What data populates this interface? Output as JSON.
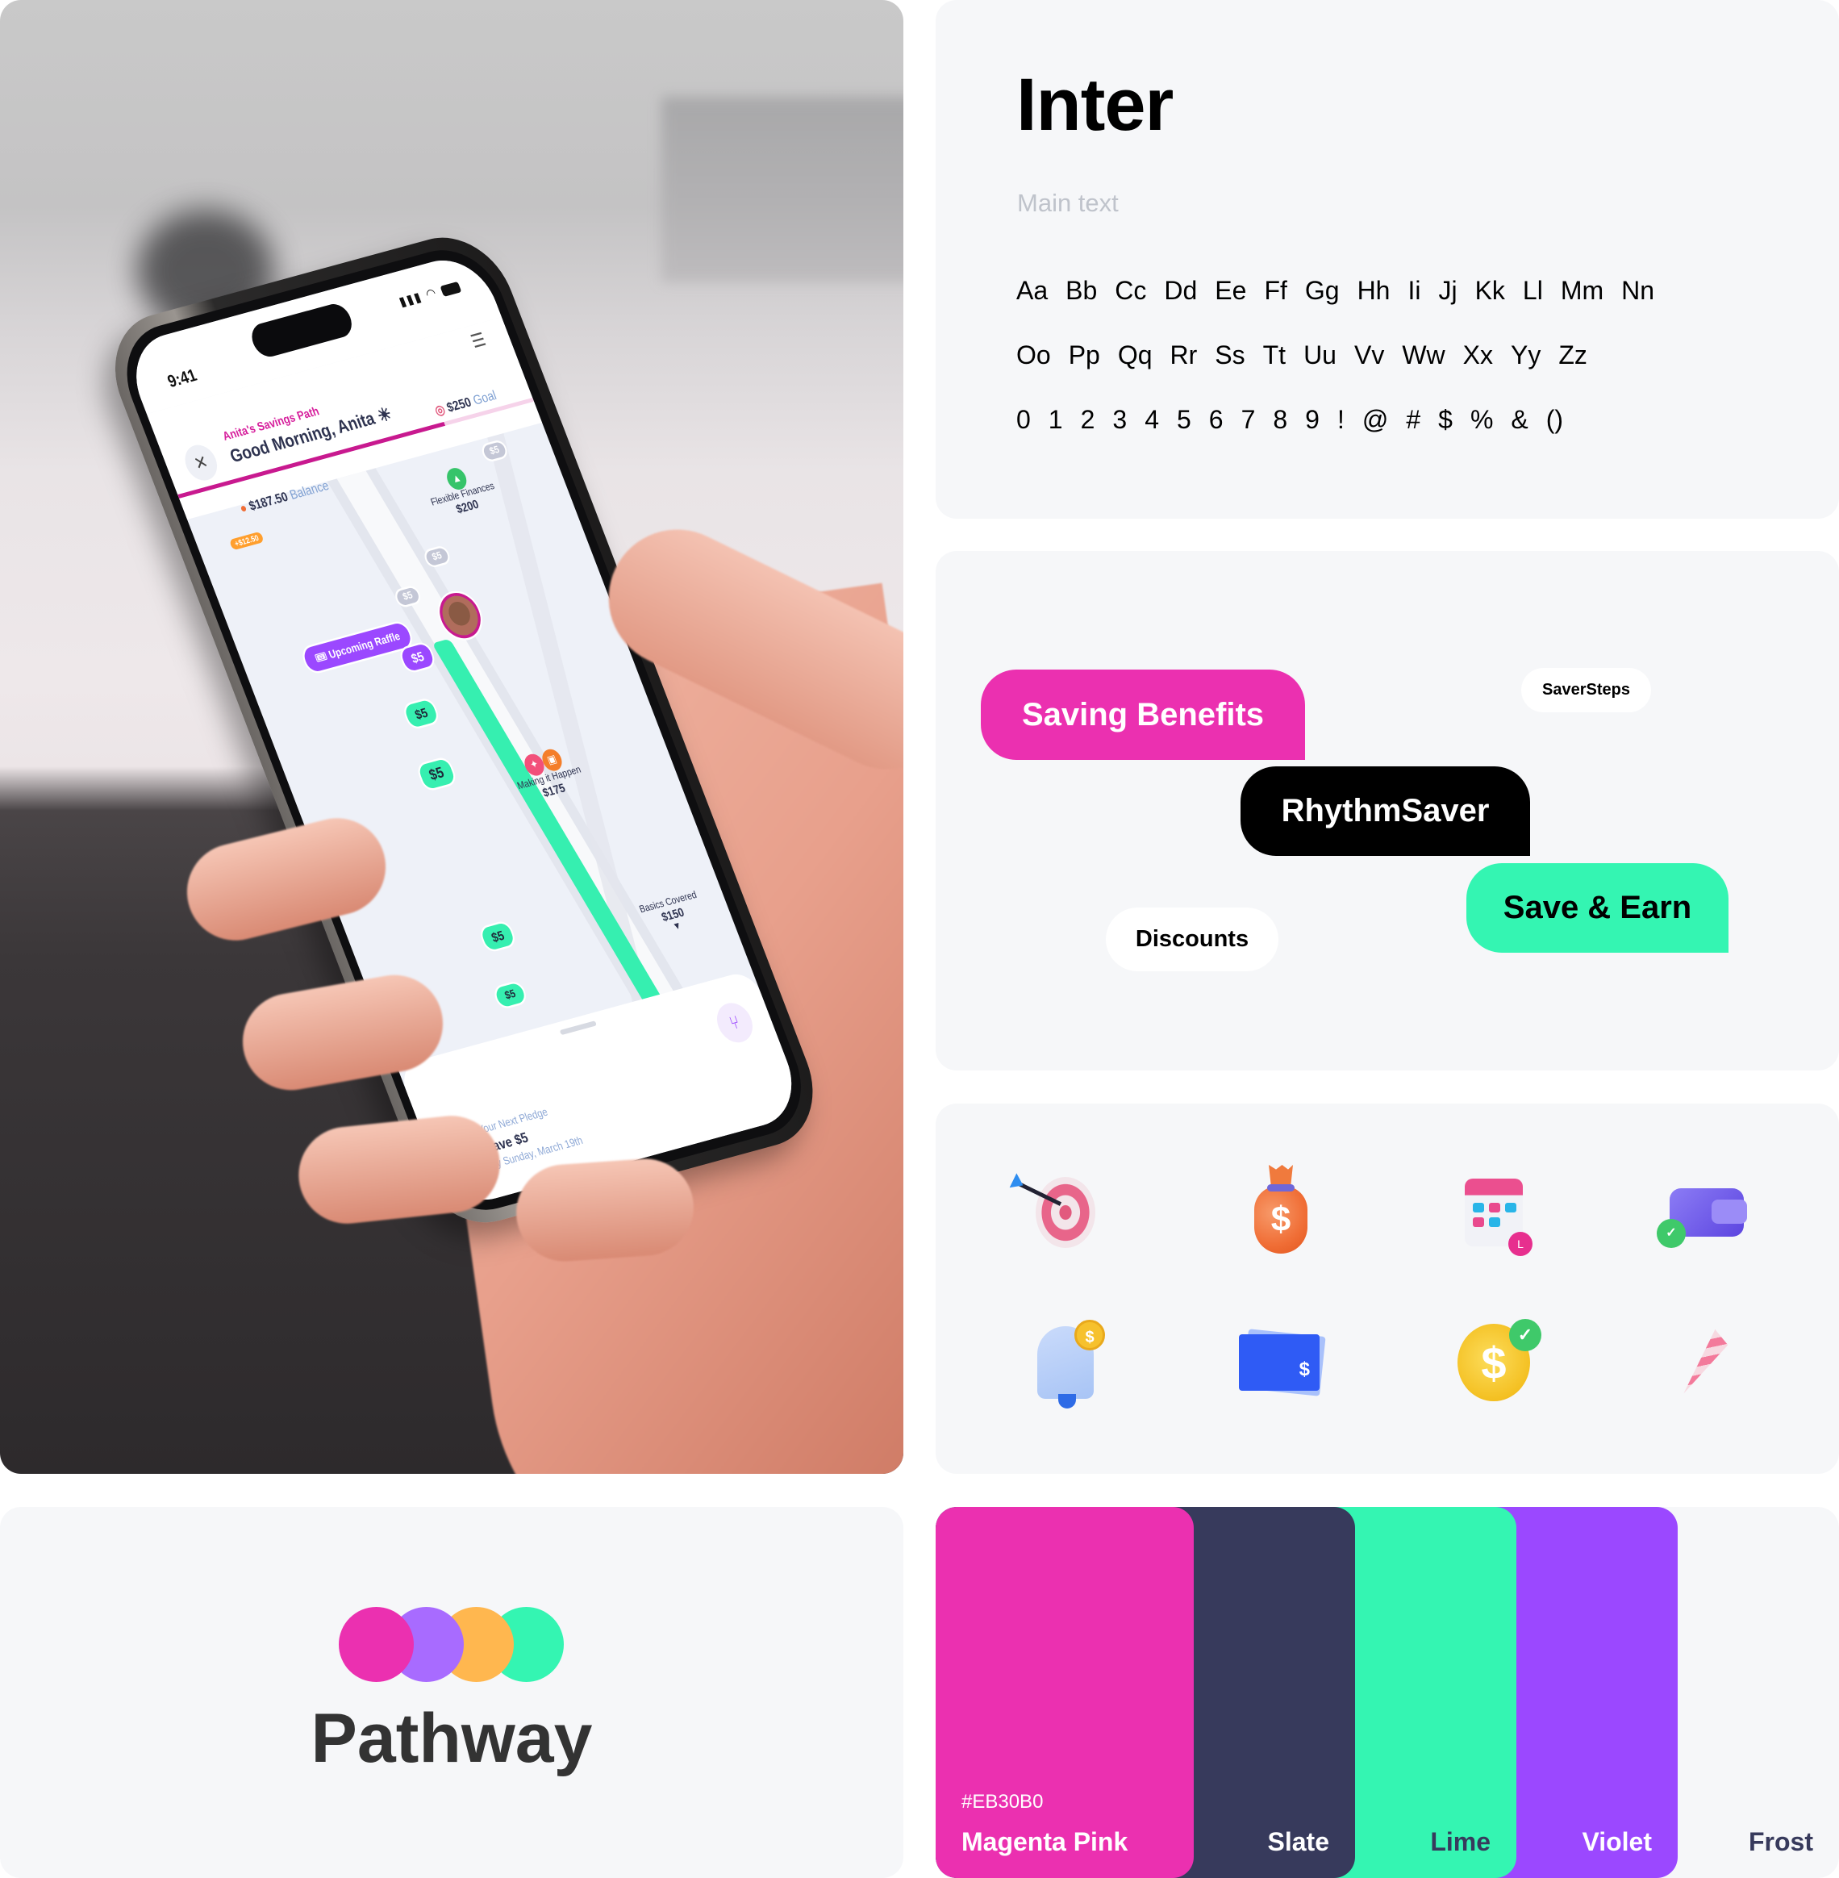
{
  "phone": {
    "status_time": "9:41",
    "path_label": "Anita's Savings Path",
    "greeting": "Good Morning, Anita ☀",
    "goal_amount": "$250",
    "goal_label": "Goal",
    "balance_amount": "$187.50",
    "balance_label": "Balance",
    "balance_change": "+$12.50",
    "progress_fraction": 0.75,
    "raffle_label": "Upcoming Raffle",
    "pledge_chip": "$5",
    "upcoming_steps": [
      "$5",
      "$5",
      "$5"
    ],
    "completed_steps": [
      "$5",
      "$5",
      "$5",
      "$5"
    ],
    "milestones": [
      {
        "name": "Flexible Finances",
        "amount": "$200"
      },
      {
        "name": "Making it Happen",
        "amount": "$175"
      },
      {
        "name": "Basics Covered",
        "amount": "$150"
      }
    ],
    "next_pledge": {
      "label": "Your Next Pledge",
      "title": "Save $5",
      "date": "by Sunday, March 19th"
    },
    "icons": {
      "close": "close-icon",
      "filter": "sliders-icon",
      "branch": "split-path-icon",
      "calendar": "calendar-icon",
      "ticket": "ticket-icon"
    }
  },
  "typography": {
    "font_name": "Inter",
    "subtitle": "Main text",
    "row1": [
      "Aa",
      "Bb",
      "Cc",
      "Dd",
      "Ee",
      "Ff",
      "Gg",
      "Hh",
      "Ii",
      "Jj",
      "Kk",
      "Ll",
      "Mm",
      "Nn"
    ],
    "row2": [
      "Oo",
      "Pp",
      "Qq",
      "Rr",
      "Ss",
      "Tt",
      "Uu",
      "Vv",
      "Ww",
      "Xx",
      "Yy",
      "Zz"
    ],
    "row3": [
      "0",
      "1",
      "2",
      "3",
      "4",
      "5",
      "6",
      "7",
      "8",
      "9",
      "!",
      "@",
      "#",
      "$",
      "%",
      "&",
      "()"
    ]
  },
  "tags": {
    "saving_benefits": "Saving Benefits",
    "saversteps": "SaverSteps",
    "rhythmsaver": "RhythmSaver",
    "save_earn": "Save & Earn",
    "discounts": "Discounts"
  },
  "icon_set": [
    "target-icon",
    "money-bag-icon",
    "calendar-icon",
    "wallet-check-icon",
    "bell-coin-icon",
    "gift-card-icon",
    "coin-check-icon",
    "party-popper-icon"
  ],
  "logo": {
    "wordmark": "Pathway",
    "circle_colors": [
      "#EB30B0",
      "#A86BFF",
      "#FFB74F",
      "#34F5B2"
    ]
  },
  "palette": [
    {
      "name": "Magenta Pink",
      "hex": "#EB30B0",
      "color": "#EB30B0",
      "text_color": "#FFFFFF"
    },
    {
      "name": "Slate",
      "color": "#373A5C",
      "text_color": "#FFFFFF"
    },
    {
      "name": "Lime",
      "color": "#34F5B2",
      "text_color": "#373A5C"
    },
    {
      "name": "Violet",
      "color": "#9B48FF",
      "text_color": "#FFFFFF"
    },
    {
      "name": "Frost",
      "color": "#F6F7F9",
      "text_color": "#373A5C"
    }
  ]
}
